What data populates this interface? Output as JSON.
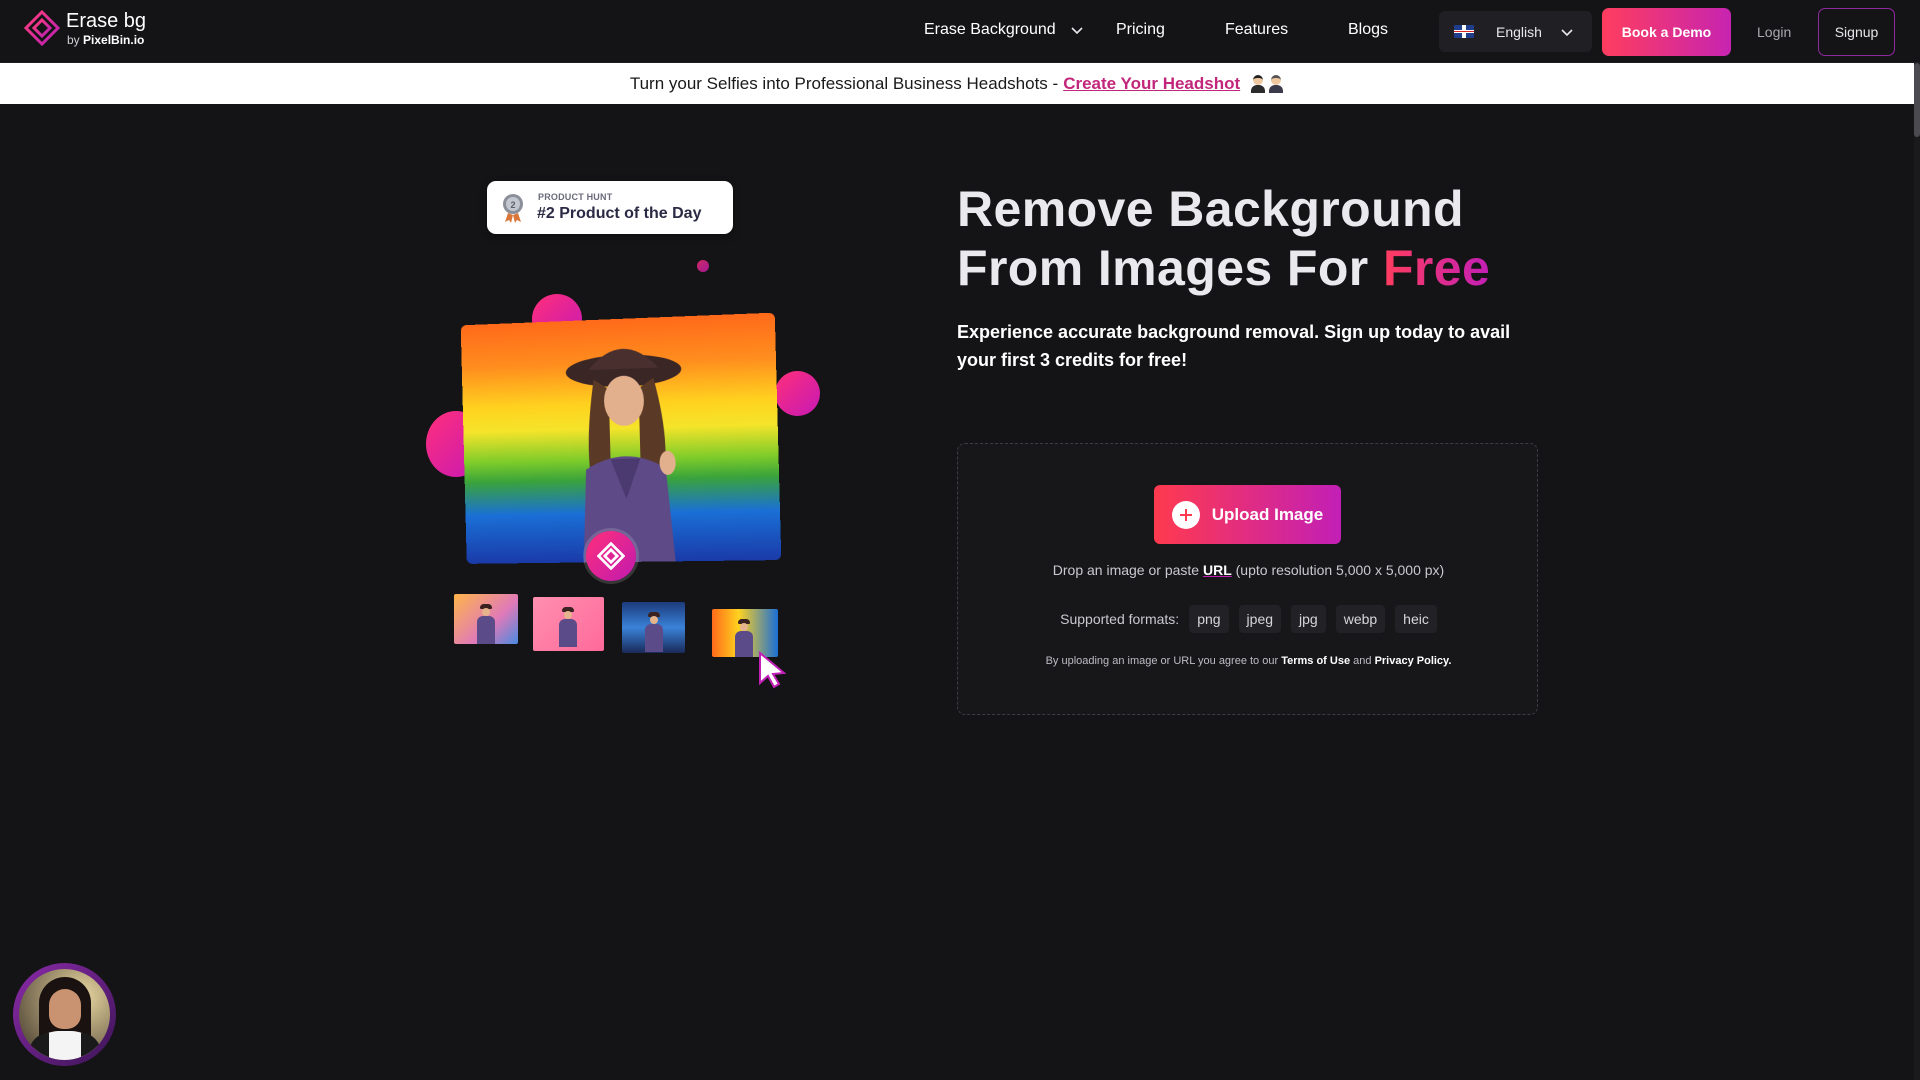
{
  "header": {
    "logo": {
      "title": "Erase bg",
      "sub_prefix": "by",
      "sub_brand": "PixelBin.io"
    },
    "nav": [
      {
        "label": "Erase Background",
        "has_dropdown": true
      },
      {
        "label": "Pricing"
      },
      {
        "label": "Features"
      },
      {
        "label": "Blogs"
      }
    ],
    "language": {
      "label": "English",
      "flag": "uk-flag-icon"
    },
    "book_demo": "Book a Demo",
    "login": "Login",
    "signup": "Signup"
  },
  "banner": {
    "text": "Turn your Selfies into Professional Business Headshots -",
    "link": "Create Your Headshot",
    "emoji": [
      "woman-office-worker-icon",
      "man-office-worker-icon"
    ]
  },
  "illustration": {
    "badge_kicker": "PRODUCT HUNT",
    "badge_title": "#2 Product of the Day",
    "medal_icon": "award-medal-icon"
  },
  "hero": {
    "title_line1": "Remove Background",
    "title_line2_prefix": "From Images For",
    "title_highlight": "Free",
    "subtitle": "Experience accurate background removal. Sign up today to avail your first 3 credits for free!"
  },
  "upload": {
    "button": "Upload Image",
    "drop_prefix": "Drop an image or paste",
    "drop_link": "URL",
    "drop_suffix": "(upto resolution 5,000 x 5,000 px)",
    "formats_label": "Supported formats:",
    "formats": [
      "png",
      "jpeg",
      "jpg",
      "webp",
      "heic"
    ],
    "terms_prefix": "By uploading an image or URL you agree to our",
    "terms_link": "Terms of Use",
    "terms_and": "and",
    "privacy_link": "Privacy Policy."
  },
  "colors": {
    "background": "#141416",
    "accent_start": "#ff3d5e",
    "accent_end": "#c21fb6",
    "banner_link": "#c2267a"
  }
}
